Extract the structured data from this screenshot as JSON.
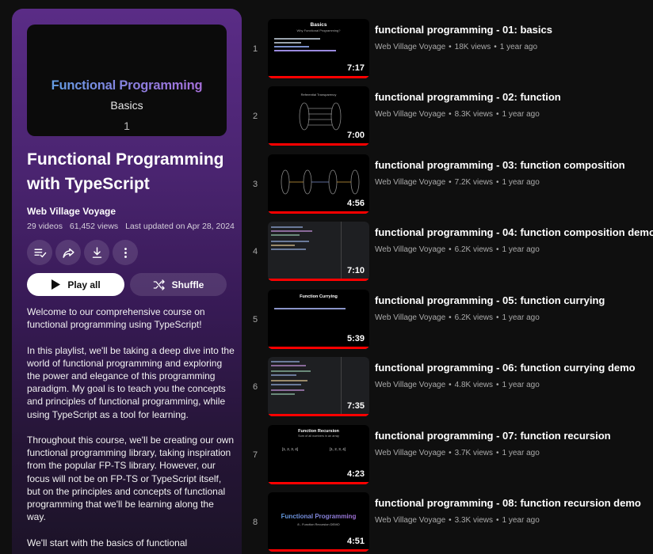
{
  "colors": {
    "accent_red": "#ff0000",
    "panel_purple": "#4a2470",
    "bg": "#0f0f0f"
  },
  "playlist": {
    "thumb": {
      "title": "Functional Programming",
      "subtitle": "Basics",
      "number": "1"
    },
    "title": "Functional Programming with TypeScript",
    "channel": "Web Village Voyage",
    "videos_count": "29 videos",
    "views": "61,452 views",
    "updated": "Last updated on Apr 28, 2024",
    "actions": {
      "save_icon": "playlist-add-icon",
      "share_icon": "share-icon",
      "download_icon": "download-icon",
      "more_icon": "more-vert-icon"
    },
    "play_all_label": "Play all",
    "shuffle_label": "Shuffle",
    "description": [
      "Welcome to our comprehensive course on functional programming using TypeScript!",
      "In this playlist, we'll be taking a deep dive into the world of functional programming and exploring the power and elegance of this programming paradigm. My goal is to teach you the concepts and principles of functional programming, while using TypeScript as a tool for learning.",
      "Throughout this course, we'll be creating our own functional programming library, taking inspiration from the popular FP-TS library. However, our focus will not be on FP-TS or TypeScript itself, but on the principles and concepts of functional programming that we'll be learning along the way.",
      "We'll start with the basics of functional"
    ]
  },
  "videos": [
    {
      "index": "1",
      "title": "functional programming - 01: basics",
      "channel": "Web Village Voyage",
      "views": "18K views",
      "age": "1 year ago",
      "duration": "7:17",
      "progress": 1.0,
      "thumb_title": "Basics",
      "thumb_sub": "Why Functional Programming?"
    },
    {
      "index": "2",
      "title": "functional programming - 02: function",
      "channel": "Web Village Voyage",
      "views": "8.3K views",
      "age": "1 year ago",
      "duration": "7:00",
      "progress": 1.0,
      "thumb_title": "Referential Transparency"
    },
    {
      "index": "3",
      "title": "functional programming - 03: function composition",
      "channel": "Web Village Voyage",
      "views": "7.2K views",
      "age": "1 year ago",
      "duration": "4:56",
      "progress": 1.0
    },
    {
      "index": "4",
      "title": "functional programming - 04: function composition demo",
      "channel": "Web Village Voyage",
      "views": "6.2K views",
      "age": "1 year ago",
      "duration": "7:10",
      "progress": 1.0
    },
    {
      "index": "5",
      "title": "functional programming - 05: function currying",
      "channel": "Web Village Voyage",
      "views": "6.2K views",
      "age": "1 year ago",
      "duration": "5:39",
      "progress": 1.0,
      "thumb_title": "Function Currying"
    },
    {
      "index": "6",
      "title": "functional programming - 06: function currying demo",
      "channel": "Web Village Voyage",
      "views": "4.8K views",
      "age": "1 year ago",
      "duration": "7:35",
      "progress": 1.0
    },
    {
      "index": "7",
      "title": "functional programming - 07: function recursion",
      "channel": "Web Village Voyage",
      "views": "3.7K views",
      "age": "1 year ago",
      "duration": "4:23",
      "progress": 1.0,
      "thumb_title": "Function Recursion",
      "thumb_sub": "Sum of all numbers in an array",
      "thumb_left": "[1, 2, 3, 4]",
      "thumb_right": "[1, 2, 3, 4]"
    },
    {
      "index": "8",
      "title": "functional programming - 08: function recursion demo",
      "channel": "Web Village Voyage",
      "views": "3.3K views",
      "age": "1 year ago",
      "duration": "4:51",
      "progress": 1.0,
      "thumb_title": "Functional Programming",
      "thumb_sub": "8 - Function Recursion DEMO"
    }
  ]
}
